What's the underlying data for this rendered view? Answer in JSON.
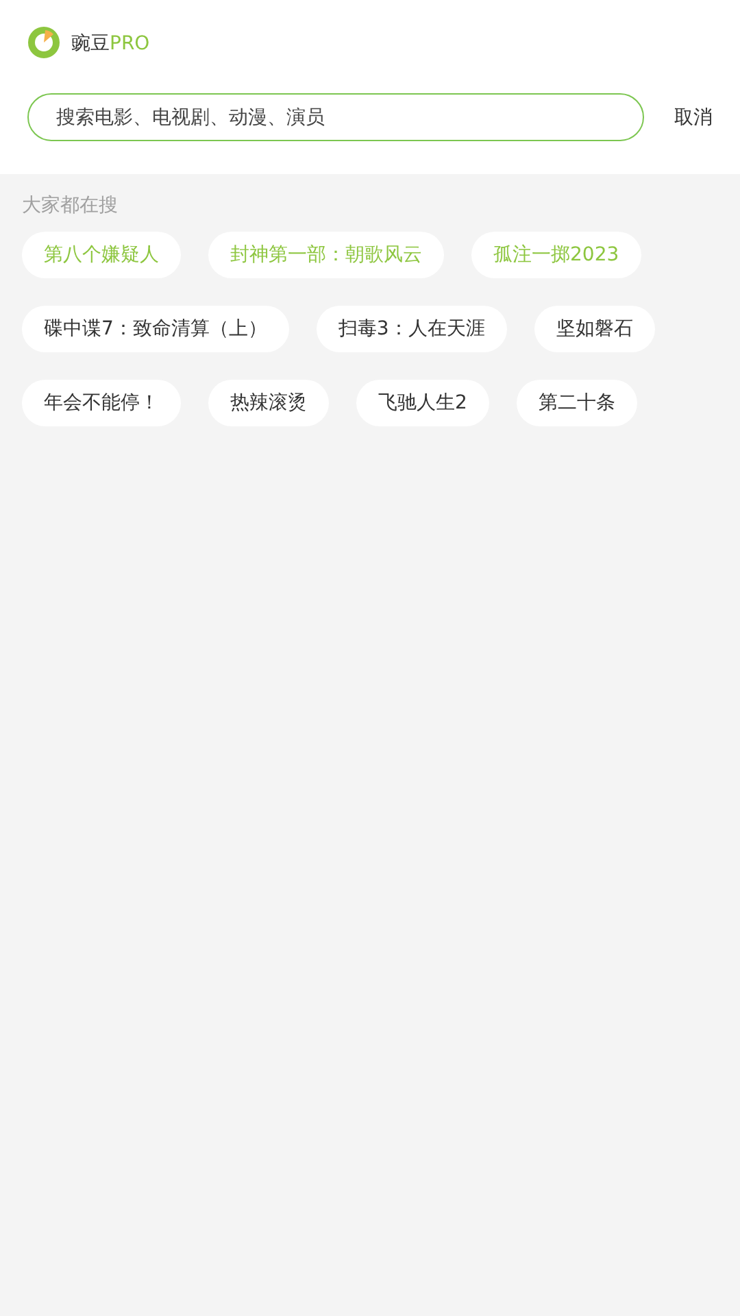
{
  "header": {
    "brand": "豌豆",
    "brand_suffix": "PRO"
  },
  "search": {
    "placeholder": "搜索电影、电视剧、动漫、演员",
    "cancel": "取消"
  },
  "trending": {
    "title": "大家都在搜",
    "tags": [
      {
        "label": "第八个嫌疑人",
        "hot": true
      },
      {
        "label": "封神第一部：朝歌风云",
        "hot": true
      },
      {
        "label": "孤注一掷2023",
        "hot": true
      },
      {
        "label": "碟中谍7：致命清算（上）",
        "hot": false
      },
      {
        "label": "扫毒3：人在天涯",
        "hot": false
      },
      {
        "label": "坚如磐石",
        "hot": false
      },
      {
        "label": "年会不能停！",
        "hot": false
      },
      {
        "label": "热辣滚烫",
        "hot": false
      },
      {
        "label": "飞驰人生2",
        "hot": false
      },
      {
        "label": "第二十条",
        "hot": false
      }
    ]
  }
}
